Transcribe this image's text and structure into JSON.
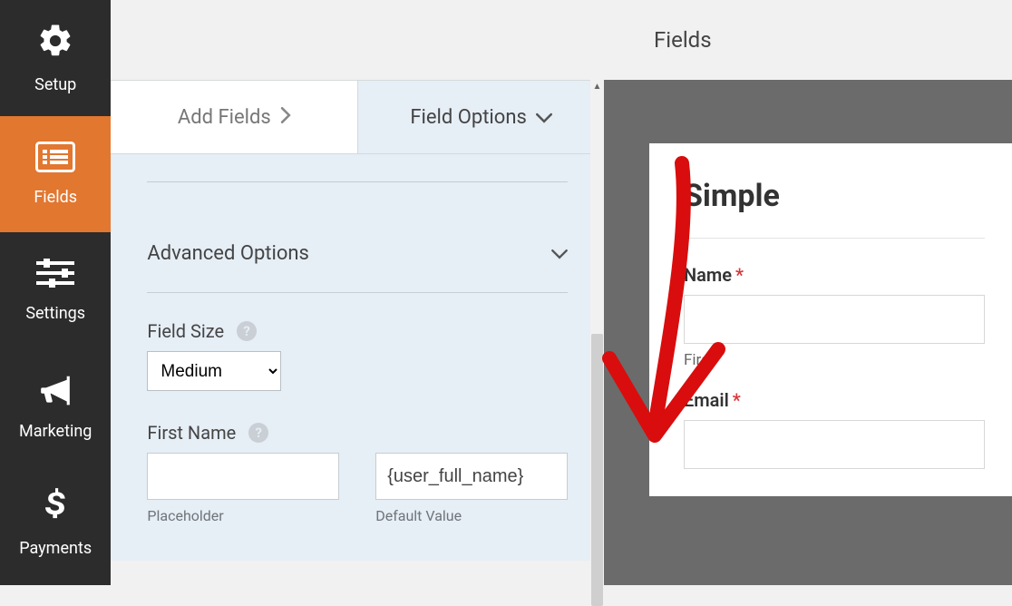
{
  "nav": {
    "items": [
      {
        "id": "setup",
        "label": "Setup"
      },
      {
        "id": "fields",
        "label": "Fields"
      },
      {
        "id": "settings",
        "label": "Settings"
      },
      {
        "id": "marketing",
        "label": "Marketing"
      },
      {
        "id": "payments",
        "label": "Payments"
      }
    ],
    "active": "fields"
  },
  "tabs": {
    "add": "Add Fields",
    "opts": "Field Options"
  },
  "panel": {
    "advanced_label": "Advanced Options",
    "field_size_label": "Field Size",
    "field_size_value": "Medium",
    "first_name_label": "First Name",
    "placeholder_value": "",
    "placeholder_sublabel": "Placeholder",
    "default_value": "{user_full_name}",
    "default_sublabel": "Default Value"
  },
  "preview": {
    "header": "Fields",
    "form_title": "Simple",
    "name_label": "Name",
    "name_sublabel": "First",
    "email_label": "Email",
    "required_mark": "*"
  }
}
